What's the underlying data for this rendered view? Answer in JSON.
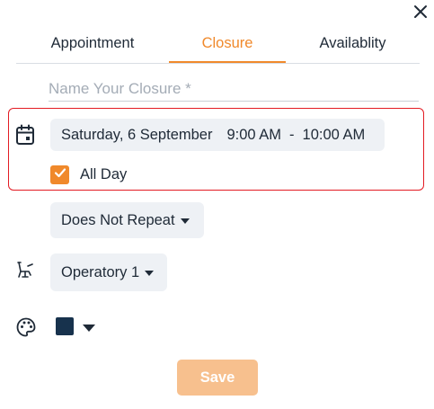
{
  "icons": {
    "close": "close-icon",
    "calendar": "calendar-icon",
    "chair": "dental-chair-icon",
    "palette": "palette-icon",
    "check": "check-icon",
    "caret": "caret-down-icon"
  },
  "tabs": [
    {
      "label": "Appointment",
      "active": false
    },
    {
      "label": "Closure",
      "active": true
    },
    {
      "label": "Availablity",
      "active": false
    }
  ],
  "name_field": {
    "value": "",
    "placeholder": "Name Your Closure *"
  },
  "date": {
    "day": "Saturday, 6 September",
    "start_time": "9:00 AM",
    "separator": "-",
    "end_time": "10:00 AM"
  },
  "all_day": {
    "label": "All Day",
    "checked": true
  },
  "repeat": {
    "label": "Does Not Repeat"
  },
  "operatory": {
    "label": "Operatory 1"
  },
  "color": {
    "selected": "#17324d"
  },
  "save_label": "Save",
  "colors": {
    "accent": "#f0892b",
    "highlight": "#e31b23",
    "save_disabled": "#f7c08e"
  }
}
